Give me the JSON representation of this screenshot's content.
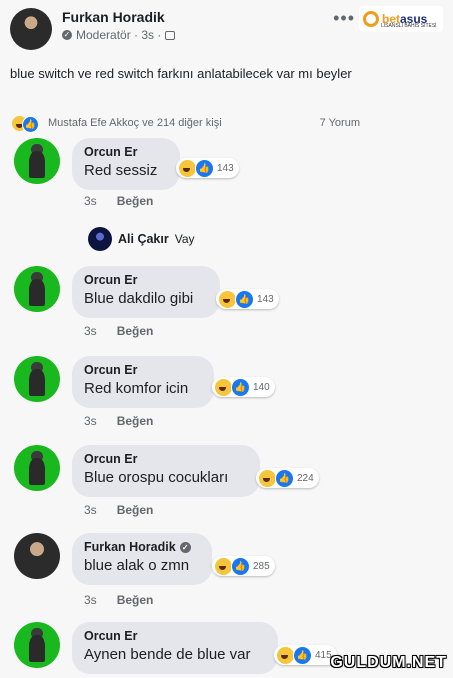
{
  "post": {
    "author": "Furkan Horadik",
    "meta": "Moderatör · 3s ·",
    "more": "•••",
    "logo": {
      "text_a": "bet",
      "text_b": "asus",
      "sub": "LİSANSLI BAHİS SİTESİ"
    },
    "text": "blue switch ve red switch farkını anlatabilecek var mı beyler",
    "reactions_text": "Mustafa Efe Akkoç ve 214 diğer kişi",
    "comments_count": "7 Yorum"
  },
  "comments": [
    {
      "name": "Orcun Er",
      "text": "Red sessiz",
      "count": "143",
      "time": "3s",
      "like": "Beğen"
    },
    {
      "name": "Orcun Er",
      "text": "Blue dakdilo gibi",
      "count": "143",
      "time": "3s",
      "like": "Beğen"
    },
    {
      "name": "Orcun Er",
      "text": "Red komfor icin",
      "count": "140",
      "time": "3s",
      "like": "Beğen"
    },
    {
      "name": "Orcun Er",
      "text": "Blue orospu cocukları",
      "count": "224",
      "time": "3s",
      "like": "Beğen"
    },
    {
      "name": "Furkan Horadik",
      "text": "blue alak o zmn",
      "count": "285",
      "time": "3s",
      "like": "Beğen"
    },
    {
      "name": "Orcun Er",
      "text": "Aynen bende de blue var",
      "count": "415"
    }
  ],
  "reply": {
    "name": "Ali Çakır",
    "text": "Vay"
  },
  "watermark": "GULDUM.NET",
  "colors": {
    "like_blue": "#1877f2",
    "haha_yellow": "#f7c53b",
    "bubble": "#e4e6eb",
    "avatar_green": "#19b81e"
  }
}
